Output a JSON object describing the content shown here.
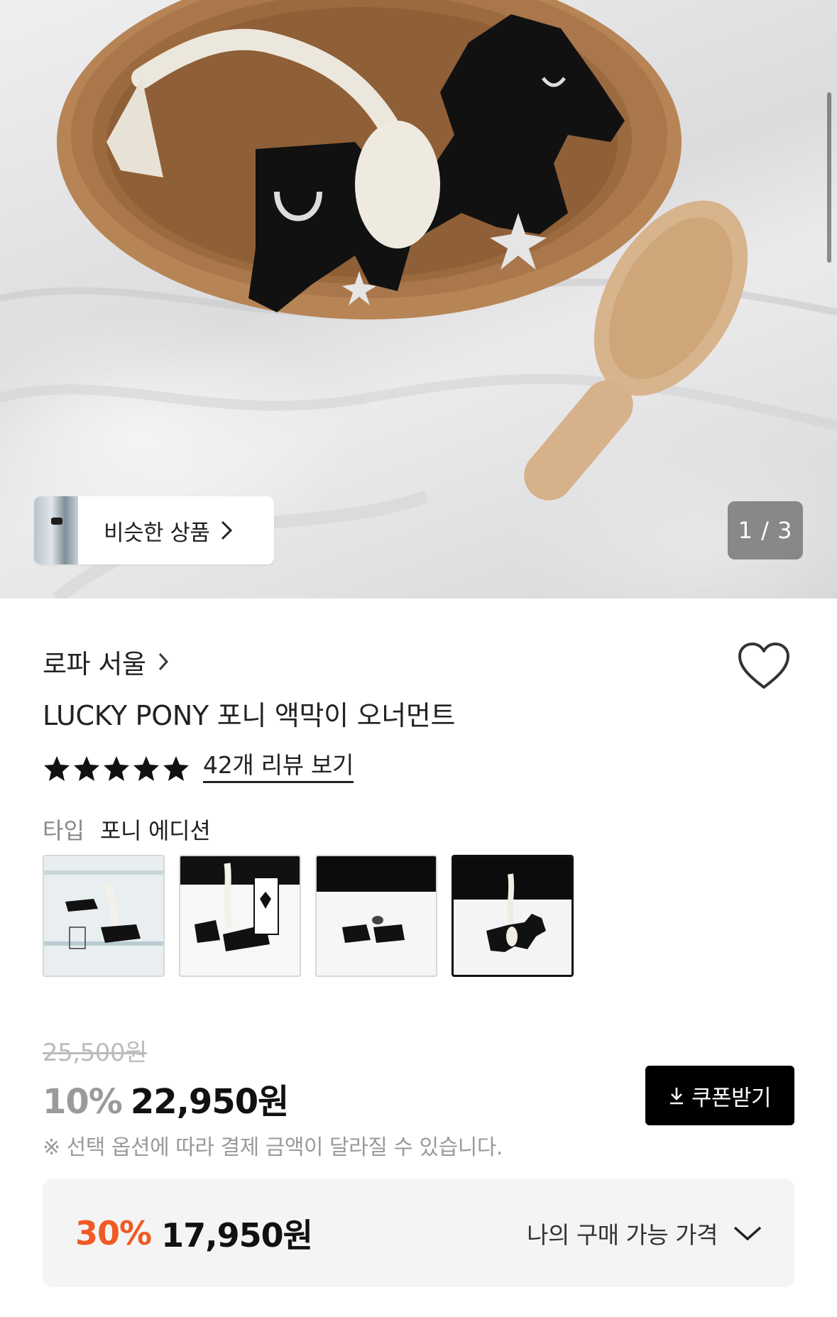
{
  "hero": {
    "similar_button_label": "비슷한 상품",
    "page_counter": "1 / 3"
  },
  "brand": {
    "name": "로파 서울"
  },
  "product": {
    "title": "LUCKY PONY 포니 액막이 오너먼트",
    "rating": 5,
    "review_link": "42개 리뷰 보기"
  },
  "options": {
    "label": "타입",
    "selected_value": "포니 에디션",
    "thumbnails": [
      {
        "name": "option-thumb-1",
        "selected": false
      },
      {
        "name": "option-thumb-2",
        "selected": false
      },
      {
        "name": "option-thumb-3",
        "selected": false
      },
      {
        "name": "option-thumb-4",
        "selected": true
      }
    ]
  },
  "price": {
    "original": "25,500원",
    "discount_rate": "10%",
    "sale_price": "22,950원",
    "coupon_button": "쿠폰받기",
    "note": "※ 선택 옵션에 따라 결제 금액이 달라질 수 있습니다."
  },
  "my_price": {
    "rate": "30%",
    "amount": "17,950원",
    "label": "나의 구매 가능 가격"
  },
  "colors": {
    "accent_orange": "#f05a24",
    "coupon_bg": "#000000",
    "muted_gray": "#9a9a9a"
  }
}
